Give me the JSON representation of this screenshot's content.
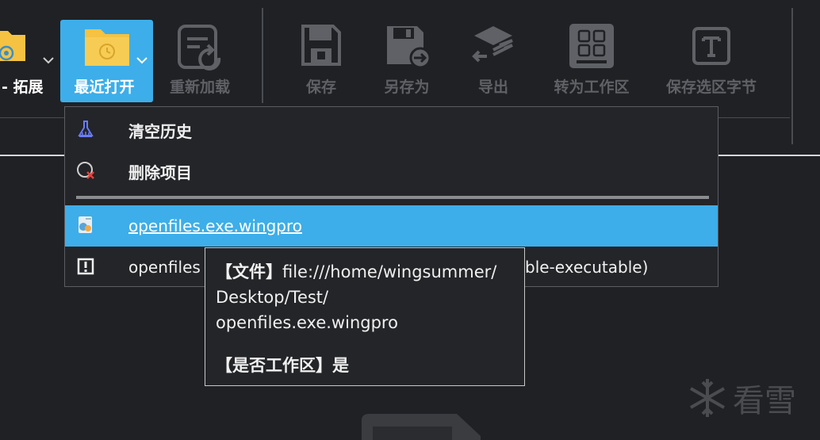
{
  "toolbar": {
    "extension_label": "- 拓展",
    "recent_label": "最近打开",
    "reload_label": "重新加载",
    "save_label": "保存",
    "save_as_label": "另存为",
    "export_label": "导出",
    "to_workspace_label": "转为工作区",
    "save_selection_label": "保存选区字节"
  },
  "menu": {
    "clear_history": "清空历史",
    "delete_item": "删除项目",
    "recent_1": "openfiles.exe.wingpro",
    "recent_2_start": "openfiles",
    "recent_2_end": "ble-executable)"
  },
  "tooltip": {
    "file_tag": "【文件】",
    "file_path_1": "file:///home/wingsummer/",
    "file_path_2": "Desktop/Test/",
    "file_path_3": "openfiles.exe.wingpro",
    "workspace_tag": "【是否工作区】",
    "workspace_value": "是"
  },
  "watermark": {
    "text": "看雪"
  },
  "colors": {
    "accent": "#3daee9",
    "background": "#202124",
    "disabled": "#5f6166",
    "folder": "#f5c242"
  }
}
